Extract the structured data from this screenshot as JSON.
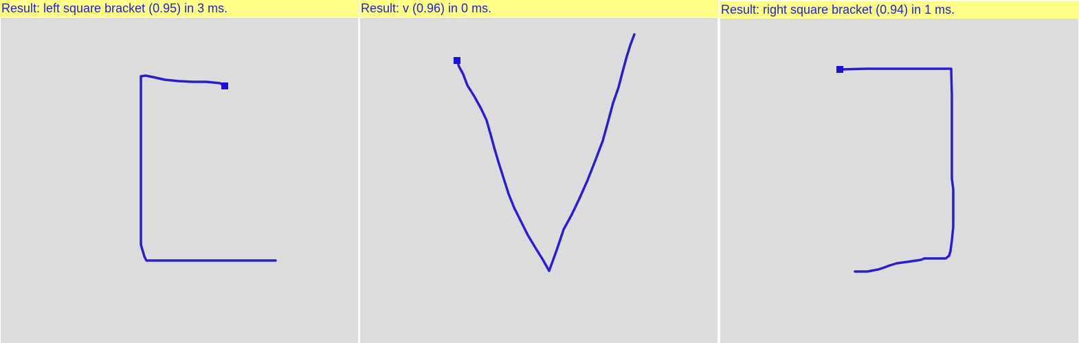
{
  "panels": [
    {
      "result_text": "Result: left square bracket (0.95) in 3 ms.",
      "gesture_name": "left square bracket",
      "score": 0.95,
      "time_ms": 3
    },
    {
      "result_text": "Result: v (0.96) in 0 ms.",
      "gesture_name": "v",
      "score": 0.96,
      "time_ms": 0
    },
    {
      "result_text": "Result: right square bracket (0.94) in 1 ms.",
      "gesture_name": "right square bracket",
      "score": 0.94,
      "time_ms": 1
    }
  ],
  "colors": {
    "result_bar_bg": "#ffff88",
    "result_text": "#2222cc",
    "canvas_bg": "#dcdcdc",
    "stroke": "#2a1bd6"
  }
}
